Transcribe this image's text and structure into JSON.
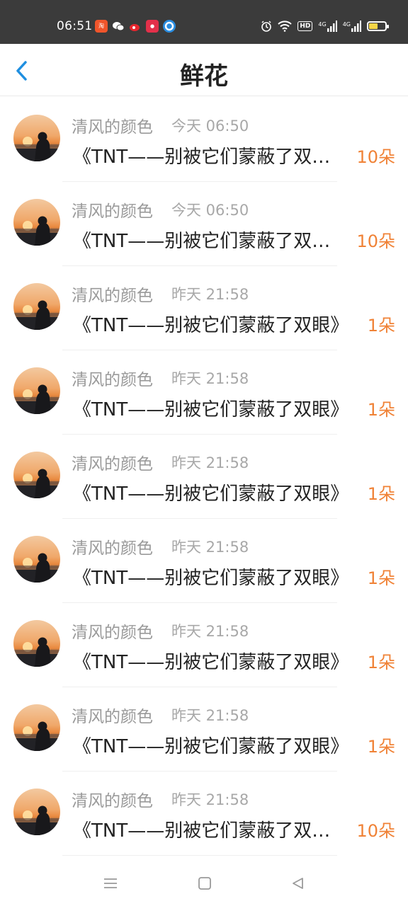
{
  "status_bar": {
    "time": "06:51",
    "notifications": [
      "taobao-icon",
      "wechat-icon",
      "weibo-icon",
      "app-red-icon",
      "app-blue-icon"
    ],
    "network": "4G",
    "hd": "HD",
    "battery_level": 0.55,
    "battery_color": "#f5d547"
  },
  "header": {
    "title": "鲜花",
    "back_icon": "chevron-left-icon",
    "accent": "#1f8fe0"
  },
  "list": {
    "items": [
      {
        "sender": "清风的颜色",
        "time": "今天 06:50",
        "message": "《TNT——别被它们蒙蔽了双眼》",
        "count": "10朵"
      },
      {
        "sender": "清风的颜色",
        "time": "今天 06:50",
        "message": "《TNT——别被它们蒙蔽了双眼》",
        "count": "10朵"
      },
      {
        "sender": "清风的颜色",
        "time": "昨天 21:58",
        "message": "《TNT——别被它们蒙蔽了双眼》",
        "count": "1朵"
      },
      {
        "sender": "清风的颜色",
        "time": "昨天 21:58",
        "message": "《TNT——别被它们蒙蔽了双眼》",
        "count": "1朵"
      },
      {
        "sender": "清风的颜色",
        "time": "昨天 21:58",
        "message": "《TNT——别被它们蒙蔽了双眼》",
        "count": "1朵"
      },
      {
        "sender": "清风的颜色",
        "time": "昨天 21:58",
        "message": "《TNT——别被它们蒙蔽了双眼》",
        "count": "1朵"
      },
      {
        "sender": "清风的颜色",
        "time": "昨天 21:58",
        "message": "《TNT——别被它们蒙蔽了双眼》",
        "count": "1朵"
      },
      {
        "sender": "清风的颜色",
        "time": "昨天 21:58",
        "message": "《TNT——别被它们蒙蔽了双眼》",
        "count": "1朵"
      },
      {
        "sender": "清风的颜色",
        "time": "昨天 21:58",
        "message": "《TNT——别被它们蒙蔽了双眼》",
        "count": "10朵"
      }
    ],
    "count_color": "#f08236"
  },
  "nav_bar": {
    "items": [
      "menu-icon",
      "home-square-icon",
      "back-triangle-icon"
    ]
  }
}
